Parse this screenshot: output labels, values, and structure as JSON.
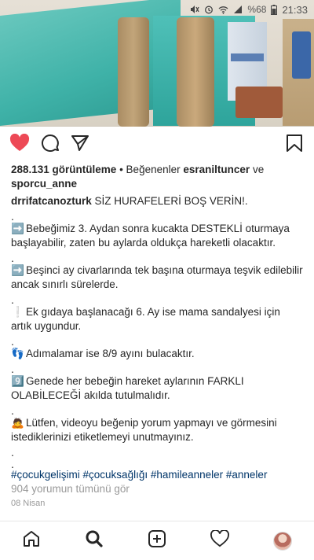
{
  "status_bar": {
    "battery_percent": "%68",
    "time": "21:33",
    "icons": [
      "mute-icon",
      "alarm-icon",
      "wifi-icon",
      "signal-icon",
      "battery-icon"
    ]
  },
  "post": {
    "views_count": "288.131 görüntüleme",
    "liked_by_prefix": "• Beğenenler",
    "liked_by_user": "esraniltuncer",
    "liked_by_and": "ve",
    "liked_by_user2": "sporcu_anne",
    "author": "drrifatcanozturk",
    "headline": "SİZ HURAFELERİ BOŞ VERİN!.",
    "paragraphs": [
      {
        "icon": "➡️",
        "icon_name": "right-arrow-icon",
        "text": "Bebeğimiz 3. Aydan sonra kucakta DESTEKLİ oturmaya başlayabilir, zaten bu aylarda oldukça hareketli olacaktır."
      },
      {
        "icon": "➡️",
        "icon_name": "right-arrow-icon",
        "text": "Beşinci ay civarlarında tek başına oturmaya teşvik edilebilir ancak sınırlı sürelerde."
      },
      {
        "icon": "❕",
        "icon_name": "exclamation-icon",
        "text": "Ek gıdaya başlanacağı 6. Ay ise mama sandalyesi için artık uygundur."
      },
      {
        "icon": "👣",
        "icon_name": "footprints-icon",
        "text": "Adımalamar ise 8/9 ayını bulacaktır."
      },
      {
        "icon": "9️⃣",
        "icon_name": "number-nine-icon",
        "text": "Genede her bebeğin hareket aylarının FARKLI OLABİLECEĞİ akılda tutulmalıdır."
      },
      {
        "icon": "🙇",
        "icon_name": "bowing-person-icon",
        "text": "Lütfen, videoyu beğenip yorum yapmayı ve görmesini istediklerinizi etiketlemeyi unutmayınız."
      }
    ],
    "dot": ".",
    "hashtags": "#çocukgelişimi #çocuksağlığı #hamileanneler #anneler",
    "comments_link": "904 yorumun tümünü gör",
    "date": "08 Nisan"
  },
  "actions": {
    "like_icon": "heart-filled-icon",
    "comment_icon": "comment-icon",
    "share_icon": "share-icon",
    "save_icon": "bookmark-icon",
    "like_color": "#ed4956"
  },
  "bottom_nav": [
    "home-icon",
    "search-icon",
    "add-icon",
    "activity-icon",
    "profile-avatar"
  ]
}
